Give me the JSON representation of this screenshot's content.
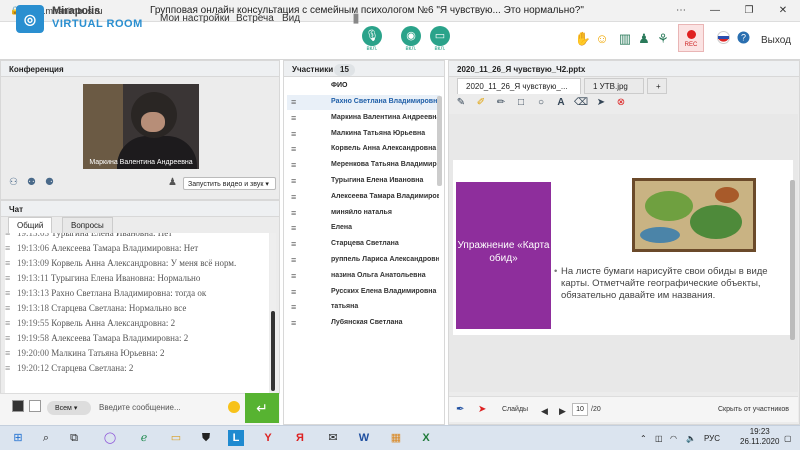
{
  "browser": {
    "url": "mf1.miranimbus.ru",
    "title": "Групповая онлайн консультация с семейным психологом №6 \"Я чувствую... Это нормально?\"",
    "minimize": "—",
    "maximize": "❐",
    "close": "✕"
  },
  "app": {
    "logo_line1": "Mirapolis",
    "logo_line2": "VIRTUAL ROOM",
    "nav": [
      "Мои настройки",
      "Встреча",
      "Вид"
    ],
    "mic_label": "вкл.",
    "cam_label": "вкл.",
    "screen_label": "вкл.",
    "rec_label": "REC",
    "exit": "Выход"
  },
  "conference": {
    "title": "Конференция",
    "video_name": "Маркина Валентина Андреевна",
    "start_video_label": "Запустить видео и звук"
  },
  "chat": {
    "title": "Чат",
    "tabs": [
      "Общий",
      "Вопросы"
    ],
    "messages": [
      {
        "time": "19:13:03",
        "text": "Турыгина Елена Ивановна: Нет"
      },
      {
        "time": "19:13:06",
        "text": "Алексеева Тамара Владимировна: Нет"
      },
      {
        "time": "19:13:09",
        "text": "Корвель Анна Александровна: У меня всё норм."
      },
      {
        "time": "19:13:11",
        "text": "Турыгина Елена Ивановна: Нормально"
      },
      {
        "time": "19:13:13",
        "text": "Рахно Светлана Владимировна: тогда ок"
      },
      {
        "time": "19:13:18",
        "text": "Старцева Светлана: Нормально все"
      },
      {
        "time": "19:19:55",
        "text": "Корвель Анна Александровна: 2"
      },
      {
        "time": "19:19:58",
        "text": "Алексеева Тамара Владимировна: 2"
      },
      {
        "time": "19:20:00",
        "text": "Малкина Татьяна Юрьевна: 2"
      },
      {
        "time": "19:20:12",
        "text": "Старцева Светлана: 2"
      }
    ],
    "recipient": "Всем",
    "input_placeholder": "Введите сообщение..."
  },
  "participants": {
    "title": "Участники",
    "count": "15",
    "column": "ФИО",
    "list": [
      "Рахно Светлана Владимировна",
      "Маркина Валентина Андреевна",
      "Малкина Татьяна Юрьевна",
      "Корвель Анна Александровна",
      "Меренкова Татьяна Владимировна",
      "Турыгина Елена Ивановна",
      "Алексеева Тамара Владимировна",
      "миняйло наталья",
      "Елена",
      "Старцева Светлана",
      "руппель Лариса Александровна",
      "назина Ольга Анатольевна",
      "Русских Елена Владимировна",
      "татьяна",
      "Лубянская Светлана"
    ]
  },
  "presentation": {
    "tabs": [
      "2020_11_26_Я чувствую_...",
      "1 УТВ.jpg",
      "+"
    ],
    "file_title": "2020_11_26_Я чувствую_Ч2.pptx",
    "slide_heading": "Упражнение «Карта обид»",
    "slide_text": "На листе бумаги нарисуйте свои обиды в виде карты. Отметчайте географические объекты, обязательно давайте им названия.",
    "footer_slides": "Слайды",
    "page": "10",
    "total": "/20",
    "hide_label": "Скрыть от участников"
  },
  "taskbar": {
    "lang": "РУС",
    "time": "19:23",
    "date": "26.11.2020"
  }
}
